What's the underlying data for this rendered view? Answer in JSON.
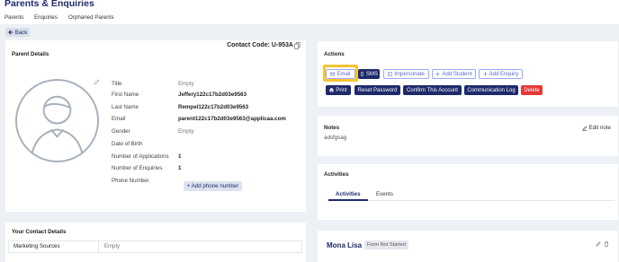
{
  "header": {
    "title": "Parents & Enquiries",
    "nav": [
      "Parents",
      "Enquiries",
      "Orphaned Parents"
    ]
  },
  "back_label": "Back",
  "parent": {
    "section_title": "Parent Details",
    "contact_code": "Contact Code: U-953A",
    "fields": [
      {
        "label": "Title",
        "value": "Empty"
      },
      {
        "label": "First Name",
        "value": "Jeffery122c17b2d03e9563"
      },
      {
        "label": "Last Name",
        "value": "Rempel122c17b2d03e9563"
      },
      {
        "label": "Email",
        "value": "parent122c17b2d03e9563@applicaa.com"
      },
      {
        "label": "Gender",
        "value": "Empty"
      },
      {
        "label": "Date of Birth",
        "value": ""
      },
      {
        "label": "Number of Applications",
        "value": "1"
      },
      {
        "label": "Number of Enquiries",
        "value": "1"
      },
      {
        "label": "Phone Number",
        "value": ""
      }
    ],
    "add_phone_label": "+ Add phone number"
  },
  "contact": {
    "section_title": "Your Contact Details",
    "marketing_label": "Marketing Sources",
    "marketing_value": "Empty"
  },
  "actions": {
    "section_title": "Actions",
    "email": "Email",
    "sms": "SMS",
    "impersonate": "Impersonate",
    "add_student": "Add Student",
    "add_enquiry": "Add Enquiry",
    "print": "Print",
    "reset_password": "Reset Password",
    "confirm_account": "Confirm This Account",
    "communication_log": "Communication Log",
    "delete": "Delete"
  },
  "notes": {
    "section_title": "Notes",
    "text": "adsfgsag",
    "edit_label": "Edit note"
  },
  "activities": {
    "section_title": "Activities",
    "tabs": [
      "Activities",
      "Events"
    ]
  },
  "student": {
    "name": "Mona Lisa",
    "status": "Form Not Started"
  },
  "colors": {
    "brand": "#1e2a6b",
    "accent_outline": "#5a67d8",
    "highlight": "#f4c534",
    "delete": "#e53935",
    "background": "#edf0f5"
  }
}
